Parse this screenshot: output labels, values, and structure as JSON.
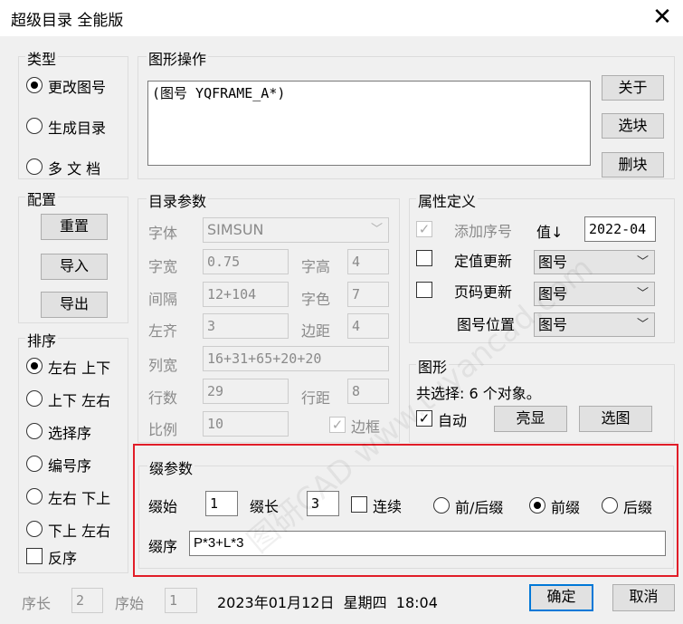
{
  "window": {
    "title": "超级目录 全能版",
    "close_glyph": "✕"
  },
  "type_group": {
    "label": "类型",
    "options": [
      "更改图号",
      "生成目录",
      "多 文 档"
    ],
    "selected": 0
  },
  "ops_group": {
    "label": "图形操作",
    "text": "(图号 YQFRAME_A*)",
    "buttons": [
      "关于",
      "选块",
      "删块"
    ]
  },
  "config_group": {
    "label": "配置",
    "buttons": [
      "重置",
      "导入",
      "导出"
    ]
  },
  "sort_group": {
    "label": "排序",
    "options": [
      "左右 上下",
      "上下 左右",
      "选择序",
      "编号序",
      "左右 下上",
      "下上 左右"
    ],
    "selected": 0,
    "reverse_label": "反序",
    "reverse_checked": false
  },
  "catalog_params": {
    "label": "目录参数",
    "font_label": "字体",
    "font_value": "SIMSUN",
    "width_label": "字宽",
    "width_value": "0.75",
    "height_label": "字高",
    "height_value": "4",
    "spacing_label": "间隔",
    "spacing_value": "12+104",
    "color_label": "字色",
    "color_value": "7",
    "left_label": "左齐",
    "left_value": "3",
    "margin_label": "边距",
    "margin_value": "4",
    "colwidth_label": "列宽",
    "colwidth_value": "16+31+65+20+20",
    "rows_label": "行数",
    "rows_value": "29",
    "rowgap_label": "行距",
    "rowgap_value": "8",
    "scale_label": "比例",
    "scale_value": "10",
    "border_label": "边框",
    "border_checked": true
  },
  "attr_group": {
    "label": "属性定义",
    "add_seq_label": "添加序号",
    "add_seq_checked": true,
    "value_label": "值↓",
    "value": "2022-04",
    "fixed_update_label": "定值更新",
    "fixed_update_select": "图号",
    "page_update_label": "页码更新",
    "page_update_select": "图号",
    "drawing_pos_label": "图号位置",
    "drawing_pos_select": "图号"
  },
  "shape_group": {
    "label": "图形",
    "selection_text": "共选择: 6 个对象。",
    "auto_label": "自动",
    "auto_checked": true,
    "highlight_button": "亮显",
    "select_button": "选图"
  },
  "suffix_params": {
    "label": "缀参数",
    "start_label": "缀始",
    "start_value": "1",
    "length_label": "缀长",
    "length_value": "3",
    "continuous_label": "连续",
    "continuous_checked": false,
    "options": [
      "前/后缀",
      "前缀",
      "后缀"
    ],
    "selected": 1,
    "order_label": "缀序",
    "order_value": "P*3+L*3"
  },
  "status": {
    "seq_len_label": "序长",
    "seq_len_value": "2",
    "seq_start_label": "序始",
    "seq_start_value": "1",
    "datetime": "2023年01月12日  星期四  18:04",
    "ok_button": "确定",
    "cancel_button": "取消"
  },
  "watermark": "图研CAD www.tuyancad.com",
  "colors": {
    "highlight_border": "#e11d28",
    "default_button_border": "#0078d7"
  }
}
